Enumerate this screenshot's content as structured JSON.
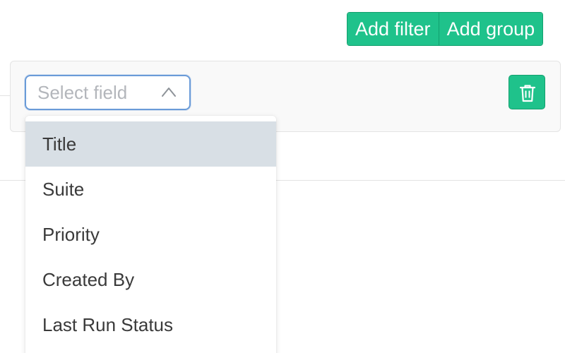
{
  "toolbar": {
    "add_filter_label": "Add filter",
    "add_group_label": "Add group"
  },
  "filter": {
    "field_select": {
      "placeholder": "Select field",
      "icon": "chevron-up-icon"
    },
    "delete_icon": "trash-icon"
  },
  "dropdown": {
    "items": [
      {
        "label": "Title",
        "highlighted": true
      },
      {
        "label": "Suite",
        "highlighted": false
      },
      {
        "label": "Priority",
        "highlighted": false
      },
      {
        "label": "Created By",
        "highlighted": false
      },
      {
        "label": "Last Run Status",
        "highlighted": false
      }
    ]
  },
  "colors": {
    "accent": "#1fc28b",
    "accent_border": "#13a06e",
    "focus_border": "#6a9bd8",
    "highlight": "#d8dfe5"
  }
}
